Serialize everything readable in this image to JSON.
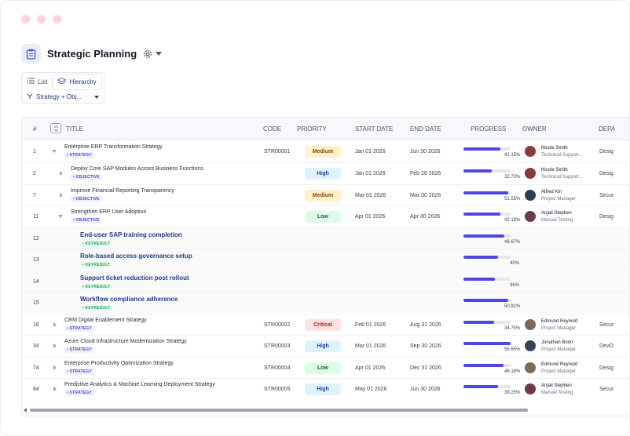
{
  "page": {
    "title": "Strategic Planning"
  },
  "view": {
    "tabs": [
      {
        "label": "List"
      },
      {
        "label": "Hierarchy"
      }
    ],
    "filter_label": "Strategy + Obj..."
  },
  "table": {
    "columns": [
      "#",
      "TITLE",
      "CODE",
      "PRIORITY",
      "START DATE",
      "END DATE",
      "PROGRESS",
      "OWNER",
      "DEPA"
    ],
    "rows": [
      {
        "num": "1",
        "level": 0,
        "expanded": true,
        "title": "Enterprise ERP Transformation Strategy",
        "tag": "STRATEGY",
        "code": "STR00001",
        "priority": "Medium",
        "start": "Jan 01 2026",
        "end": "Jun 30 2026",
        "progress": 42.15,
        "progress_label": "42.15%",
        "owner": "Nicole Smith",
        "role": "Technical Support...",
        "dept": "Desig"
      },
      {
        "num": "2",
        "level": 1,
        "expanded": false,
        "title": "Deploy Core SAP Modules Across Business Functions",
        "tag": "OBJECTIVE",
        "code": "",
        "priority": "High",
        "start": "Jan 01 2026",
        "end": "Feb 28 2026",
        "progress": 32.73,
        "progress_label": "32.73%",
        "owner": "Nicole Smith",
        "role": "Technical Support...",
        "dept": "Desig"
      },
      {
        "num": "7",
        "level": 1,
        "expanded": false,
        "title": "Improve Financial Reporting Transparency",
        "tag": "OBJECTIVE",
        "code": "",
        "priority": "Medium",
        "start": "Mar 01 2026",
        "end": "Mar 30 2026",
        "progress": 51.55,
        "progress_label": "51.55%",
        "owner": "Alfred Kin",
        "role": "Project Manager",
        "dept": "Secur"
      },
      {
        "num": "11",
        "level": 1,
        "expanded": true,
        "title": "Strengthen ERP User Adoption",
        "tag": "OBJECTIVE",
        "code": "",
        "priority": "Low",
        "start": "Apr 01 2026",
        "end": "Apr 30 2026",
        "progress": 42.18,
        "progress_label": "42.18%",
        "owner": "Anjali Stephen",
        "role": "Manual Testing",
        "dept": "Desig"
      },
      {
        "num": "12",
        "level": 2,
        "expanded": null,
        "title": "End-user SAP training completion",
        "tag": "KEYRESULT",
        "code": "",
        "priority": "",
        "start": "",
        "end": "",
        "progress": 46.67,
        "progress_label": "46.67%",
        "owner": "",
        "role": "",
        "dept": ""
      },
      {
        "num": "13",
        "level": 2,
        "expanded": null,
        "title": "Role-based access governance setup",
        "tag": "KEYRESULT",
        "code": "",
        "priority": "",
        "start": "",
        "end": "",
        "progress": 40,
        "progress_label": "40%",
        "owner": "",
        "role": "",
        "dept": ""
      },
      {
        "num": "14",
        "level": 2,
        "expanded": null,
        "title": "Support ticket reduction post rollout",
        "tag": "KEYRESULT",
        "code": "",
        "priority": "",
        "start": "",
        "end": "",
        "progress": 36,
        "progress_label": "36%",
        "owner": "",
        "role": "",
        "dept": ""
      },
      {
        "num": "15",
        "level": 2,
        "expanded": null,
        "title": "Workflow compliance adherence",
        "tag": "KEYRESULT",
        "code": "",
        "priority": "",
        "start": "",
        "end": "",
        "progress": 50.91,
        "progress_label": "50.91%",
        "owner": "",
        "role": "",
        "dept": ""
      },
      {
        "num": "16",
        "level": 0,
        "expanded": false,
        "title": "CRM Digital Enablement Strategy",
        "tag": "STRATEGY",
        "code": "STR00002",
        "priority": "Critical",
        "start": "Feb 01 2026",
        "end": "Aug 31 2026",
        "progress": 34.75,
        "progress_label": "34.75%",
        "owner": "Edmund Reynold",
        "role": "Project Manager",
        "dept": "Secur"
      },
      {
        "num": "34",
        "level": 0,
        "expanded": false,
        "title": "Azure Cloud Infrastructure Modernization Strategy",
        "tag": "STRATEGY",
        "code": "STR00003",
        "priority": "High",
        "start": "Mar 01 2026",
        "end": "Sep 30 2026",
        "progress": 55.65,
        "progress_label": "55.65%",
        "owner": "Jonathan Boon",
        "role": "Project Manager",
        "dept": "DevO"
      },
      {
        "num": "74",
        "level": 0,
        "expanded": false,
        "title": "Enterprise Productivity Optimization Strategy",
        "tag": "STRATEGY",
        "code": "STR00004",
        "priority": "Low",
        "start": "Apr 01 2026",
        "end": "Dec 31 2026",
        "progress": 46.18,
        "progress_label": "46.18%",
        "owner": "Edmund Reynold",
        "role": "Project Manager",
        "dept": "Desig"
      },
      {
        "num": "84",
        "level": 0,
        "expanded": false,
        "title": "Predictive Analytics & Machine Learning Deployment Strategy",
        "tag": "STRATEGY",
        "code": "STR00005",
        "priority": "High",
        "start": "May 01 2026",
        "end": "Jun 30 2026",
        "progress": 39.25,
        "progress_label": "39.25%",
        "owner": "Anjali Stephen",
        "role": "Manual Testing",
        "dept": "Secur"
      }
    ]
  },
  "colors": {
    "accent": "#4f46e5",
    "kr_title": "#1e3a8a"
  },
  "icons": [
    "clipboard-icon",
    "gear-icon",
    "list-icon",
    "hierarchy-icon",
    "sort-icon",
    "filter-icon"
  ]
}
